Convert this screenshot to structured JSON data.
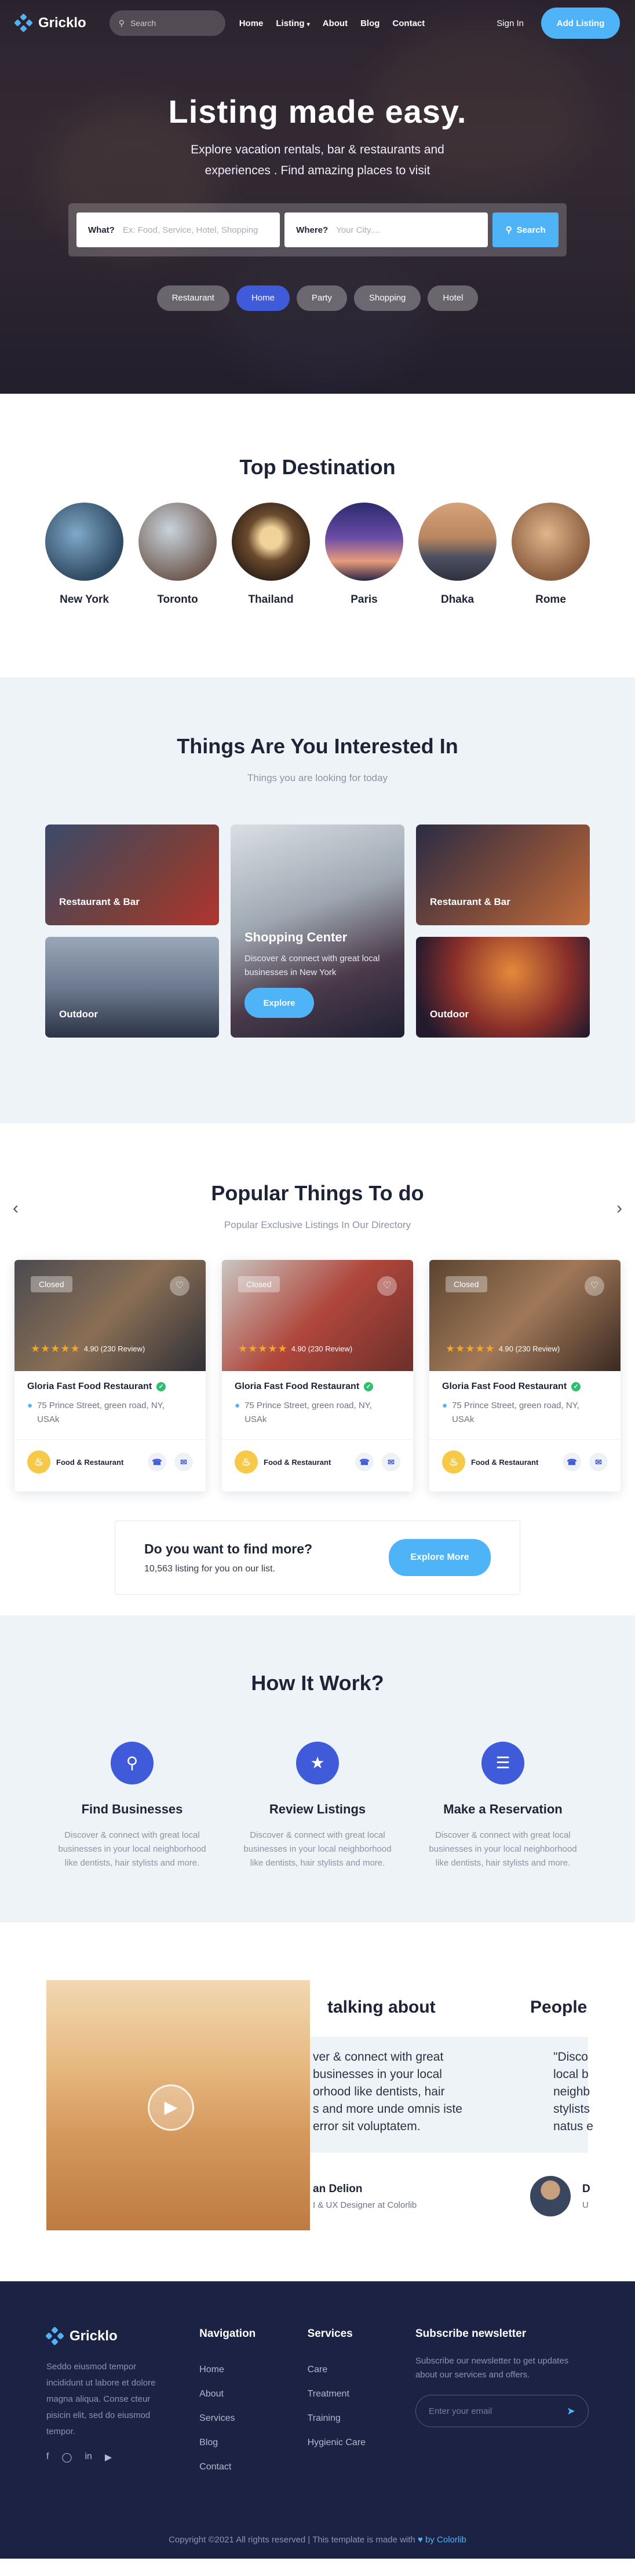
{
  "nav": {
    "brand": "Gricklo",
    "search_placeholder": "Search",
    "links": [
      "Home",
      "Listing",
      "About",
      "Blog",
      "Contact"
    ],
    "signin": "Sign In",
    "add_listing": "Add Listing"
  },
  "hero": {
    "title": "Listing made easy.",
    "subtitle_line1": "Explore vacation rentals, bar & restaurants and",
    "subtitle_line2": "experiences . Find amazing places to visit",
    "what_label": "What?",
    "what_placeholder": "Ex: Food, Service, Hotel, Shopping",
    "where_label": "Where?",
    "where_placeholder": "Your City....",
    "search_button": "Search",
    "chips": [
      "Restaurant",
      "Home",
      "Party",
      "Shopping",
      "Hotel"
    ],
    "active_chip": "Home"
  },
  "destinations": {
    "title": "Top Destination",
    "items": [
      "New York",
      "Toronto",
      "Thailand",
      "Paris",
      "Dhaka",
      "Rome"
    ]
  },
  "interest": {
    "title": "Things Are You Interested In",
    "subtitle": "Things you are looking for today",
    "tiles": [
      "Restaurant & Bar",
      "Outdoor",
      "Restaurant & Bar",
      "Outdoor"
    ],
    "featured": {
      "title": "Shopping Center",
      "text": "Discover & connect with great local businesses in New York",
      "button": "Explore"
    }
  },
  "popular": {
    "title": "Popular Things To do",
    "subtitle": "Popular Exclusive Listings In Our Directory",
    "cards": [
      {
        "status": "Closed",
        "rating": "4.90 (230 Review)",
        "name": "Gloria Fast Food Restaurant",
        "address_line1": "75 Prince Street, green road, NY,",
        "address_line2": "USAk",
        "category": "Food & Restaurant"
      },
      {
        "status": "Closed",
        "rating": "4.90 (230 Review)",
        "name": "Gloria Fast Food Restaurant",
        "address_line1": "75 Prince Street, green road, NY,",
        "address_line2": "USAk",
        "category": "Food & Restaurant"
      },
      {
        "status": "Closed",
        "rating": "4.90 (230 Review)",
        "name": "Gloria Fast Food Restaurant",
        "address_line1": "75 Prince Street, green road, NY,",
        "address_line2": "USAk",
        "category": "Food & Restaurant"
      }
    ],
    "find_more_title": "Do you want to find more?",
    "find_more_text": "10,563 listing for you on our list.",
    "find_more_button": "Explore More"
  },
  "how": {
    "title": "How It Work?",
    "items": [
      {
        "title": "Find Businesses",
        "text1": "Discover & connect with great local",
        "text2": "businesses in your local neighborhood",
        "text3": "like dentists, hair stylists and more.",
        "icon": "search-icon"
      },
      {
        "title": "Review Listings",
        "text1": "Discover & connect with great local",
        "text2": "businesses in your local neighborhood",
        "text3": "like dentists, hair stylists and more.",
        "icon": "star-icon"
      },
      {
        "title": "Make a Reservation",
        "text1": "Discover & connect with great local",
        "text2": "businesses in your local neighborhood",
        "text3": "like dentists, hair stylists and more.",
        "icon": "list-icon"
      }
    ]
  },
  "testimonial": {
    "title_a": "talking about",
    "title_b": "People",
    "quote_a1": "ver & connect with great",
    "quote_a2": "businesses in your local",
    "quote_a3": "orhood like dentists, hair",
    "quote_a4": "s and more unde omnis iste",
    "quote_a5": "error sit voluptatem.",
    "name_a": "an Delion",
    "role_a": "I & UX Designer at Colorlib",
    "quote_b1": "\"Disco",
    "quote_b2": "local b",
    "quote_b3": "neighb",
    "quote_b4": "stylists",
    "quote_b5": "natus e",
    "name_b": "D",
    "role_b": "U"
  },
  "footer": {
    "brand": "Gricklo",
    "about_line1": "Seddo eiusmod tempor",
    "about_line2": "incididunt ut labore et dolore",
    "about_line3": "magna aliqua. Conse cteur",
    "about_line4": "pisicin elit, sed do eiusmod",
    "about_line5": "tempor.",
    "nav_title": "Navigation",
    "nav_items": [
      "Home",
      "About",
      "Services",
      "Blog",
      "Contact"
    ],
    "services_title": "Services",
    "services_items": [
      "Care",
      "Treatment",
      "Training",
      "Hygienic Care"
    ],
    "newsletter_title": "Subscribe newsletter",
    "newsletter_text1": "Subscribe our newsletter to get updates",
    "newsletter_text2": "about our services and offers.",
    "email_placeholder": "Enter your email",
    "copyright": "Copyright ©2021 All rights reserved | This template is made with",
    "colorlib": "by Colorlib"
  },
  "colors": {
    "accent": "#4fb4f7",
    "primary": "#3f5bd9",
    "footer": "#1c2243",
    "star": "#f5a623"
  }
}
